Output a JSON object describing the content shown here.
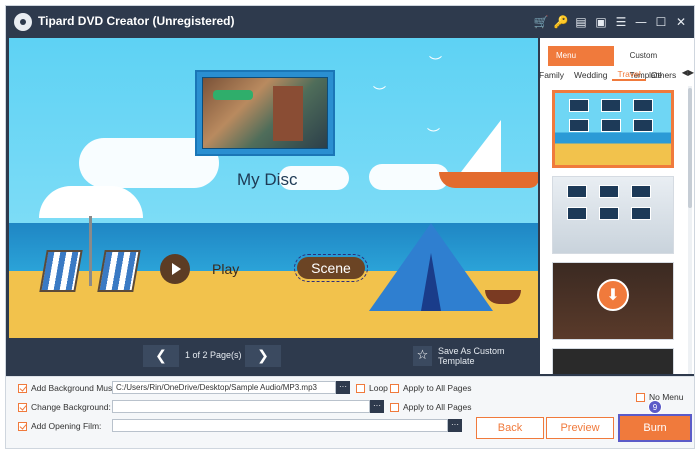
{
  "app": {
    "title": "Tipard DVD Creator (Unregistered)",
    "title_icons": [
      "cart-icon",
      "key-icon",
      "document-icon",
      "chat-icon",
      "menu-icon",
      "minimize-icon",
      "maximize-icon",
      "close-icon"
    ],
    "title_icon_glyphs": [
      "🛒",
      "🔑",
      "▤",
      "▣",
      "☰",
      "—",
      "☐",
      "✕"
    ]
  },
  "preview": {
    "disc_title": "My Disc",
    "play_label": "Play",
    "scene_label": "Scene",
    "prev_glyph": "❮",
    "next_glyph": "❯",
    "page_info": "1 of 2 Page(s)",
    "save_template_label": "Save As Custom Template",
    "star_glyph": "☆"
  },
  "template_panel": {
    "tabs": [
      "Menu Template",
      "Custom Template"
    ],
    "active_tab": "Menu Template",
    "categories": [
      "Family",
      "Wedding",
      "Travel",
      "Others"
    ],
    "active_category": "Travel",
    "nav_arrows": "◀▶",
    "download_glyph": "⬇"
  },
  "options": {
    "background_music": {
      "label": "Add Background Music:",
      "checked": true,
      "value": "C:/Users/Rin/OneDrive/Desktop/Sample Audio/MP3.mp3"
    },
    "loop": {
      "label": "Loop",
      "checked": false
    },
    "apply_all_music": {
      "label": "Apply to All Pages",
      "checked": false
    },
    "change_background": {
      "label": "Change Background:",
      "checked": true,
      "value": ""
    },
    "apply_all_bg": {
      "label": "Apply to All Pages",
      "checked": false
    },
    "opening_film": {
      "label": "Add Opening Film:",
      "checked": true,
      "value": ""
    },
    "no_menu": {
      "label": "No Menu",
      "checked": false
    },
    "browse_label": "···"
  },
  "actions": {
    "back": "Back",
    "preview": "Preview",
    "burn": "Burn",
    "badge": "9"
  },
  "colors": {
    "accent": "#f07a3c",
    "window_dark": "#2e3a4d",
    "badge": "#5b5bc8"
  }
}
